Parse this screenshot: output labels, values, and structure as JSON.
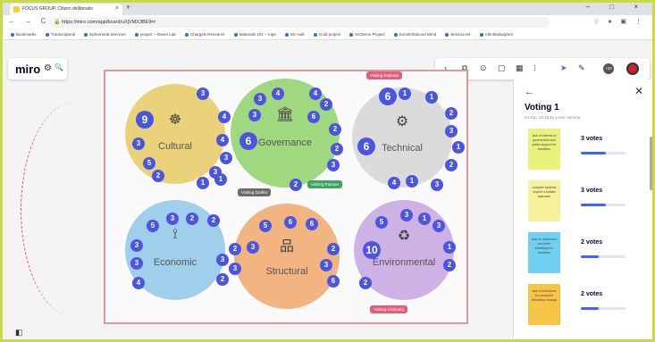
{
  "browser": {
    "tab_title": "FOCUS GROUP, Citizen deliberatio",
    "tab_close": "×",
    "new_tab": "+",
    "window_controls": "– □ ×",
    "nav": "← → C",
    "url": "https://miro.com/app/board/uXjVMX3BE9=/",
    "lock": "🔒",
    "extensions": "☆ ♠ ▣ ⋮",
    "bookmarks": [
      "Bookmarks",
      "Transcripteral",
      "Ephemeral Services",
      "project – Green Lab",
      "ChargeN Research",
      "Materials 101 – rupe",
      "5G Hub",
      "Gold project",
      "KKDemo Project",
      "EuroEnhanced Wind",
      "BioGov.net",
      "Alle Bladwijzers"
    ]
  },
  "miro": {
    "logo": "miro",
    "settings_icon": "⚙",
    "search_icon": "🔍",
    "toolbar_icons": [
      "›",
      "⧉",
      "⊙",
      "▢",
      "▦",
      "⁝",
      "➤",
      "✎"
    ],
    "participant_count": "+20"
  },
  "clusters": [
    {
      "label": "Cultural",
      "icon": "☸",
      "color": "#e6c85a",
      "votes": [
        "3",
        "9",
        "4",
        "3",
        "4",
        "3",
        "5",
        "3",
        "2",
        "1",
        "1"
      ]
    },
    {
      "label": "Governance",
      "icon": "🏛",
      "color": "#8fd16a",
      "votes": [
        "3",
        "4",
        "4",
        "2",
        "6",
        "3",
        "6",
        "2",
        "2",
        "3",
        "2"
      ]
    },
    {
      "label": "Technical",
      "icon": "⚙",
      "color": "#bdbdbd",
      "votes": [
        "6",
        "1",
        "1",
        "2",
        "3",
        "1",
        "6",
        "2",
        "4",
        "1",
        "3"
      ]
    },
    {
      "label": "Economic",
      "icon": "⟟",
      "color": "#8ec7e6",
      "votes": [
        "5",
        "3",
        "2",
        "2",
        "3",
        "3",
        "3",
        "4",
        "2"
      ]
    },
    {
      "label": "Structural",
      "icon": "品",
      "color": "#f0a76a",
      "votes": [
        "5",
        "6",
        "6",
        "2",
        "2",
        "3",
        "3",
        "6",
        "3"
      ]
    },
    {
      "label": "Environmental",
      "icon": "♻",
      "color": "#c7a5e0",
      "votes": [
        "5",
        "3",
        "1",
        "3",
        "10",
        "1",
        "2",
        "2"
      ]
    }
  ],
  "cursors": {
    "explorer": "Visiting Explorer",
    "pioneer": "Visiting Pioneer",
    "drafter": "Visiting Drafter",
    "visionary": "Visiting Visionary"
  },
  "voting_panel": {
    "back": "←",
    "close": "✕",
    "title": "Voting 1",
    "subtitle": "04 Jun, 12:15 by Louis Homme",
    "items": [
      {
        "note": "lack of interest of government and public support for transition",
        "votes_label": "3 votes",
        "fraction": 0.55,
        "note_color": "#e9f27a"
      },
      {
        "note": "complex systems require a holistic approach",
        "votes_label": "3 votes",
        "fraction": 0.55,
        "note_color": "#f6f19a"
      },
      {
        "note": "lack of consumers and other incentives for transition",
        "votes_label": "2 votes",
        "fraction": 0.4,
        "note_color": "#6fd0f2"
      },
      {
        "note": "lack of incentives for consumer behaviour change",
        "votes_label": "2 votes",
        "fraction": 0.4,
        "note_color": "#f6c545"
      }
    ]
  },
  "bottom": {
    "panel_icon": "◧"
  }
}
